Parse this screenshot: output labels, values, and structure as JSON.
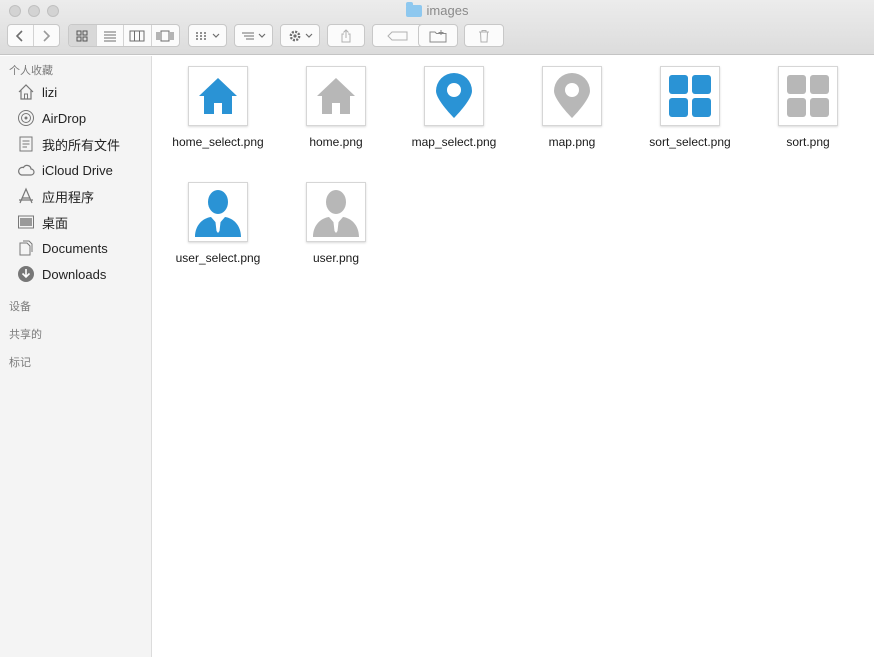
{
  "window": {
    "title": "images"
  },
  "toolbar": {
    "back_icon": "chevron-left-icon",
    "forward_icon": "chevron-right-icon",
    "view_modes": [
      "icon-view",
      "list-view",
      "column-view",
      "cover-flow-view"
    ],
    "arrange_icon": "arrange-grid-icon",
    "sort_icon": "sort-lines-icon",
    "action_icon": "gear-icon",
    "share_icon": "share-icon",
    "tag_icon": "tag-icon",
    "new_folder_icon": "new-folder-icon",
    "trash_icon": "trash-icon"
  },
  "sidebar": {
    "favorites_header": "个人收藏",
    "items": [
      {
        "label": "lizi",
        "icon": "home-icon"
      },
      {
        "label": "AirDrop",
        "icon": "airdrop-icon"
      },
      {
        "label": "我的所有文件",
        "icon": "all-files-icon"
      },
      {
        "label": "iCloud Drive",
        "icon": "cloud-icon"
      },
      {
        "label": "应用程序",
        "icon": "applications-icon"
      },
      {
        "label": "桌面",
        "icon": "desktop-icon"
      },
      {
        "label": "Documents",
        "icon": "documents-icon"
      },
      {
        "label": "Downloads",
        "icon": "downloads-icon"
      }
    ],
    "devices_header": "设备",
    "shared_header": "共享的",
    "tags_header": "标记"
  },
  "files": [
    {
      "name": "home_select.png",
      "icon": "home-icon",
      "color": "#2a93d5"
    },
    {
      "name": "home.png",
      "icon": "home-icon",
      "color": "#b7b7b7"
    },
    {
      "name": "map_select.png",
      "icon": "map-pin-icon",
      "color": "#2a93d5"
    },
    {
      "name": "map.png",
      "icon": "map-pin-icon",
      "color": "#b7b7b7"
    },
    {
      "name": "sort_select.png",
      "icon": "grid-icon",
      "color": "#2a93d5"
    },
    {
      "name": "sort.png",
      "icon": "grid-icon",
      "color": "#b7b7b7"
    },
    {
      "name": "user_select.png",
      "icon": "user-icon",
      "color": "#2a93d5"
    },
    {
      "name": "user.png",
      "icon": "user-icon",
      "color": "#b7b7b7"
    }
  ]
}
